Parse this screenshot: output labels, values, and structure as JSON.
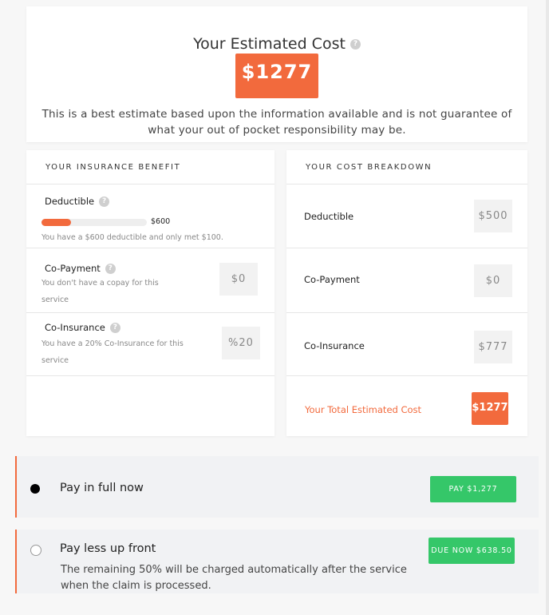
{
  "estimate": {
    "title": "Your Estimated Cost",
    "amount": "$1277",
    "note": "This is a best estimate based upon the information available and is not guarantee of what your out of pocket responsibility may be."
  },
  "benefit": {
    "header": "YOUR INSURANCE BENEFIT",
    "deductible": {
      "label": "Deductible",
      "met_fraction": 0.28,
      "max_label": "$600",
      "note": "You have a $600 deductible and only met $100."
    },
    "copay": {
      "label": "Co-Payment",
      "note": "You don't have a copay for this service",
      "value": "$0"
    },
    "coinsurance": {
      "label": "Co-Insurance",
      "note": "You have a 20% Co-Insurance for this service",
      "value": "%20"
    }
  },
  "breakdown": {
    "header": "YOUR COST BREAKDOWN",
    "rows": [
      {
        "label": "Deductible",
        "value": "$500"
      },
      {
        "label": "Co-Payment",
        "value": "$0"
      },
      {
        "label": "Co-Insurance",
        "value": "$777"
      }
    ],
    "total_label": "Your Total Estimated Cost",
    "total_value": "$1277"
  },
  "payment": {
    "full": {
      "title": "Pay in full now",
      "button": "PAY $1,277",
      "selected": true
    },
    "partial": {
      "title": "Pay less up front",
      "description": "The remaining 50% will be charged automatically after the service when the claim is processed.",
      "button": "DUE NOW $638.50",
      "selected": false
    }
  },
  "colors": {
    "accent": "#f26a3d",
    "success": "#35c769",
    "panel": "#f1f2f4"
  }
}
